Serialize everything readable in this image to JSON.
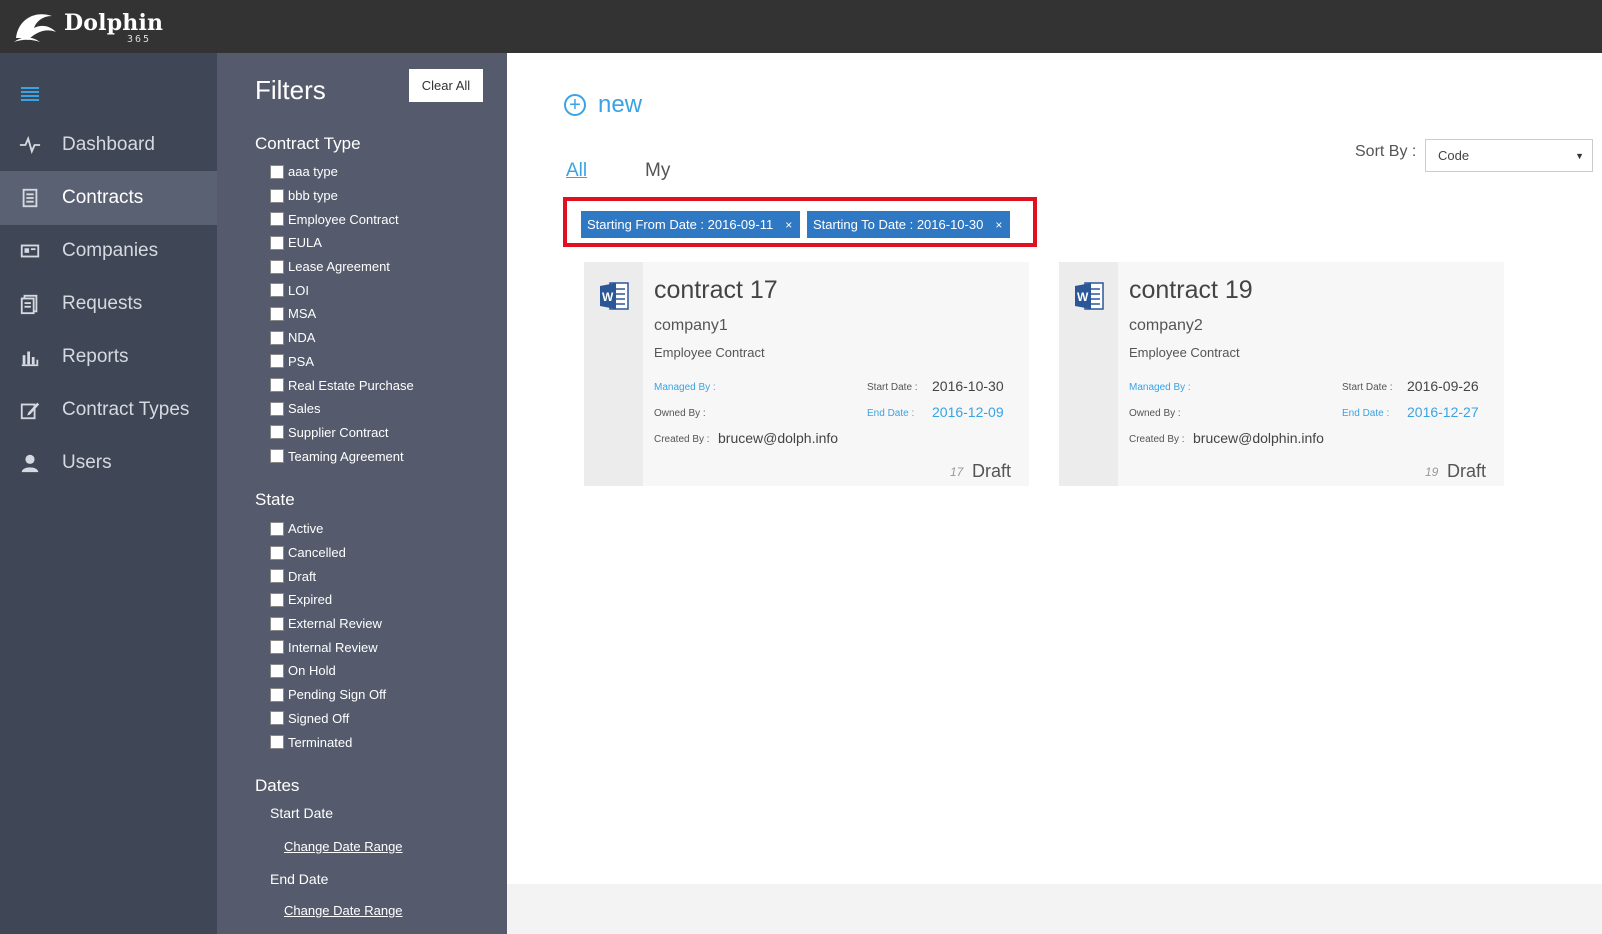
{
  "app": {
    "name": "Dolphin",
    "sub": "365"
  },
  "nav": {
    "items": [
      {
        "label": "Dashboard",
        "icon": "pulse-icon"
      },
      {
        "label": "Contracts",
        "icon": "document-icon",
        "active": true
      },
      {
        "label": "Companies",
        "icon": "id-card-icon"
      },
      {
        "label": "Requests",
        "icon": "request-icon"
      },
      {
        "label": "Reports",
        "icon": "bar-chart-icon"
      },
      {
        "label": "Contract Types",
        "icon": "edit-icon"
      },
      {
        "label": "Users",
        "icon": "user-icon"
      }
    ]
  },
  "filters": {
    "title": "Filters",
    "clear_all": "Clear All",
    "contract_type": {
      "title": "Contract Type",
      "options": [
        "aaa type",
        "bbb type",
        "Employee Contract",
        "EULA",
        "Lease Agreement",
        "LOI",
        "MSA",
        "NDA",
        "PSA",
        "Real Estate Purchase",
        "Sales",
        "Supplier Contract",
        "Teaming Agreement"
      ]
    },
    "state": {
      "title": "State",
      "options": [
        "Active",
        "Cancelled",
        "Draft",
        "Expired",
        "External Review",
        "Internal Review",
        "On Hold",
        "Pending Sign Off",
        "Signed Off",
        "Terminated"
      ]
    },
    "dates": {
      "title": "Dates",
      "start_date": "Start Date",
      "end_date": "End Date",
      "change_range": "Change Date Range"
    }
  },
  "main": {
    "new_label": "new",
    "tabs": {
      "all": "All",
      "my": "My"
    },
    "sort_by": {
      "label": "Sort By :",
      "value": "Code"
    },
    "tags": [
      {
        "label": "Starting From Date : 2016-09-11",
        "remove": "×"
      },
      {
        "label": "Starting To Date : 2016-10-30",
        "remove": "×"
      }
    ],
    "labels": {
      "managed_by": "Managed By :",
      "owned_by": "Owned By :",
      "created_by": "Created By :",
      "start_date": "Start Date :",
      "end_date": "End Date :"
    },
    "cards": [
      {
        "name": "contract 17",
        "company": "company1",
        "type": "Employee Contract",
        "start_date": "2016-10-30",
        "end_date": "2016-12-09",
        "created_by": "brucew@dolph.info",
        "number": "17",
        "status": "Draft"
      },
      {
        "name": "contract 19",
        "company": "company2",
        "type": "Employee Contract",
        "start_date": "2016-09-26",
        "end_date": "2016-12-27",
        "created_by": "brucew@dolphin.info",
        "number": "19",
        "status": "Draft"
      }
    ]
  },
  "colors": {
    "accent": "#3aa3e3",
    "tag": "#2f78c4",
    "highlight": "#e01020",
    "topbar": "#333333",
    "nav": "#3f4656",
    "filters": "#555b6c"
  }
}
